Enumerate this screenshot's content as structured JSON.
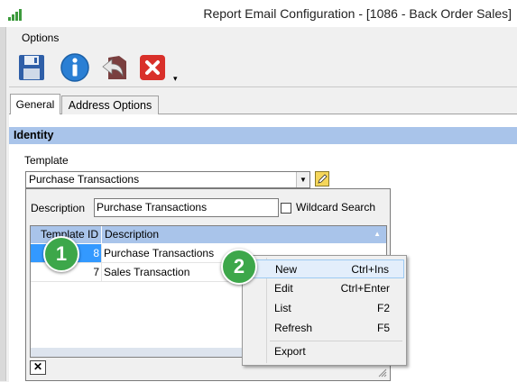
{
  "window": {
    "title": "Report Email Configuration - [1086 - Back Order Sales]"
  },
  "menu": {
    "options": "Options"
  },
  "toolbar": {
    "icons": [
      "save-icon",
      "info-icon",
      "undo-icon",
      "close-icon"
    ],
    "dropdown_glyph": "▾"
  },
  "tabs": [
    {
      "label": "General",
      "active": true
    },
    {
      "label": "Address Options",
      "active": false
    }
  ],
  "identity": {
    "header": "Identity",
    "template_label": "Template",
    "template_value": "Purchase Transactions"
  },
  "lookup": {
    "description_label": "Description",
    "description_value": "Purchase Transactions",
    "wildcard_label": "Wildcard Search",
    "wildcard_checked": false,
    "columns": [
      "Template ID",
      "Description"
    ],
    "rows": [
      {
        "id": "8",
        "description": "Purchase Transactions",
        "selected": true
      },
      {
        "id": "7",
        "description": "Sales Transaction",
        "selected": false
      }
    ],
    "close_glyph": "✕"
  },
  "context_menu": {
    "items": [
      {
        "label": "New",
        "shortcut": "Ctrl+Ins",
        "highlighted": true
      },
      {
        "label": "Edit",
        "shortcut": "Ctrl+Enter"
      },
      {
        "label": "List",
        "shortcut": "F2"
      },
      {
        "label": "Refresh",
        "shortcut": "F5"
      },
      {
        "label": "Export",
        "shortcut": ""
      }
    ]
  },
  "callouts": [
    "1",
    "2"
  ],
  "colors": {
    "header_blue": "#a9c4ea",
    "selection_blue": "#3399ff",
    "callout_green": "#3da74a"
  }
}
